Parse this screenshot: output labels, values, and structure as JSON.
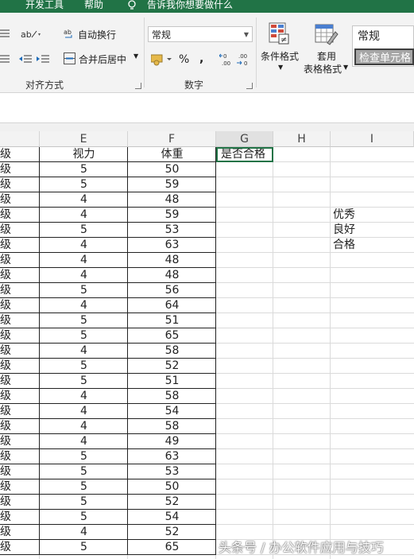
{
  "ribbon_tabs": [
    "开发工具",
    "帮助",
    "告诉我你想要做什么"
  ],
  "ribbon": {
    "wrap_text": "自动换行",
    "merge_center": "合并后居中",
    "align_group": "对齐方式",
    "number_format": "常规",
    "percent": "%",
    "comma": ",",
    "inc_decimal": "←0\n.00",
    "dec_decimal": ".00\n→0",
    "number_group": "数字",
    "cond_format": "条件格式",
    "table_format_1": "套用",
    "table_format_2": "表格格式",
    "style_normal": "常规",
    "style_check": "检查单元格"
  },
  "columns": [
    "E",
    "F",
    "G",
    "H",
    "I"
  ],
  "header_row": {
    "d": "级",
    "e": "视力",
    "f": "体重",
    "g": "是否合格"
  },
  "rows": [
    {
      "d": "级",
      "e": "5",
      "f": "50"
    },
    {
      "d": "级",
      "e": "5",
      "f": "59"
    },
    {
      "d": "级",
      "e": "4",
      "f": "48"
    },
    {
      "d": "级",
      "e": "4",
      "f": "59"
    },
    {
      "d": "级",
      "e": "5",
      "f": "53"
    },
    {
      "d": "级",
      "e": "4",
      "f": "63"
    },
    {
      "d": "级",
      "e": "4",
      "f": "48"
    },
    {
      "d": "级",
      "e": "4",
      "f": "48"
    },
    {
      "d": "级",
      "e": "5",
      "f": "56"
    },
    {
      "d": "级",
      "e": "4",
      "f": "64"
    },
    {
      "d": "级",
      "e": "5",
      "f": "51"
    },
    {
      "d": "级",
      "e": "5",
      "f": "65"
    },
    {
      "d": "级",
      "e": "4",
      "f": "58"
    },
    {
      "d": "级",
      "e": "5",
      "f": "52"
    },
    {
      "d": "级",
      "e": "5",
      "f": "51"
    },
    {
      "d": "级",
      "e": "4",
      "f": "58"
    },
    {
      "d": "级",
      "e": "4",
      "f": "54"
    },
    {
      "d": "级",
      "e": "4",
      "f": "58"
    },
    {
      "d": "级",
      "e": "4",
      "f": "49"
    },
    {
      "d": "级",
      "e": "5",
      "f": "63"
    },
    {
      "d": "级",
      "e": "5",
      "f": "53"
    },
    {
      "d": "级",
      "e": "5",
      "f": "50"
    },
    {
      "d": "级",
      "e": "5",
      "f": "52"
    },
    {
      "d": "级",
      "e": "5",
      "f": "54"
    },
    {
      "d": "级",
      "e": "4",
      "f": "52"
    },
    {
      "d": "级",
      "e": "5",
      "f": "65"
    }
  ],
  "grade_list": [
    "优秀",
    "良好",
    "合格"
  ],
  "watermark": "头条号 / 办公软件应用与技巧",
  "colors": {
    "excel_green": "#217346",
    "selected_gray": "#a5a5a5"
  }
}
